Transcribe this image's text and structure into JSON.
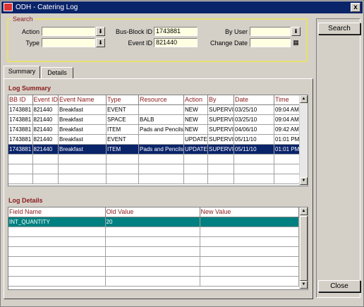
{
  "window": {
    "title": "ODH - Catering Log",
    "close_glyph": "x"
  },
  "search": {
    "legend": "Search",
    "action_label": "Action",
    "action_value": "",
    "type_label": "Type",
    "type_value": "",
    "bbid_label": "Bus-Block ID",
    "bbid_value": "1743881",
    "eventid_label": "Event ID",
    "eventid_value": "821440",
    "byuser_label": "By User",
    "byuser_value": "",
    "changedate_label": "Change Date",
    "changedate_value": "",
    "dropdown_glyph": "⬇",
    "calendar_glyph": "▦"
  },
  "buttons": {
    "search": "Search",
    "close": "Close"
  },
  "tabs": [
    {
      "label": "Summary"
    },
    {
      "label": "Details"
    }
  ],
  "log_summary": {
    "title": "Log Summary",
    "columns": [
      "BB ID",
      "Event ID",
      "Event Name",
      "Type",
      "Resource",
      "Action",
      "By",
      "Date",
      "Time"
    ],
    "rows": [
      [
        "1743881",
        "821440",
        "Breakfast",
        "EVENT",
        "",
        "NEW",
        "SUPERVI",
        "03/25/10",
        "09:04 AM"
      ],
      [
        "1743881",
        "821440",
        "Breakfast",
        "SPACE",
        "BALB",
        "NEW",
        "SUPERVI",
        "03/25/10",
        "09:04 AM"
      ],
      [
        "1743881",
        "821440",
        "Breakfast",
        "ITEM",
        "Pads and Pencils",
        "NEW",
        "SUPERVI",
        "04/06/10",
        "09:42 AM"
      ],
      [
        "1743881",
        "821440",
        "Breakfast",
        "EVENT",
        "",
        "UPDATE",
        "SUPERVI",
        "05/11/10",
        "01:01 PM"
      ],
      [
        "1743881",
        "821440",
        "Breakfast",
        "ITEM",
        "Pads and Pencils",
        "UPDATE",
        "SUPERVI",
        "05/11/10",
        "01:01 PM"
      ]
    ],
    "selected_row": 4
  },
  "log_details": {
    "title": "Log Details",
    "columns": [
      "Field Name",
      "Old Value",
      "New Value"
    ],
    "rows": [
      [
        "INT_QUANTITY",
        "20",
        ""
      ]
    ]
  },
  "colors": {
    "accent": "#0a246a",
    "label_red": "#8b1a1a",
    "teal_row": "#008080",
    "field_bg": "#ffffe1"
  }
}
